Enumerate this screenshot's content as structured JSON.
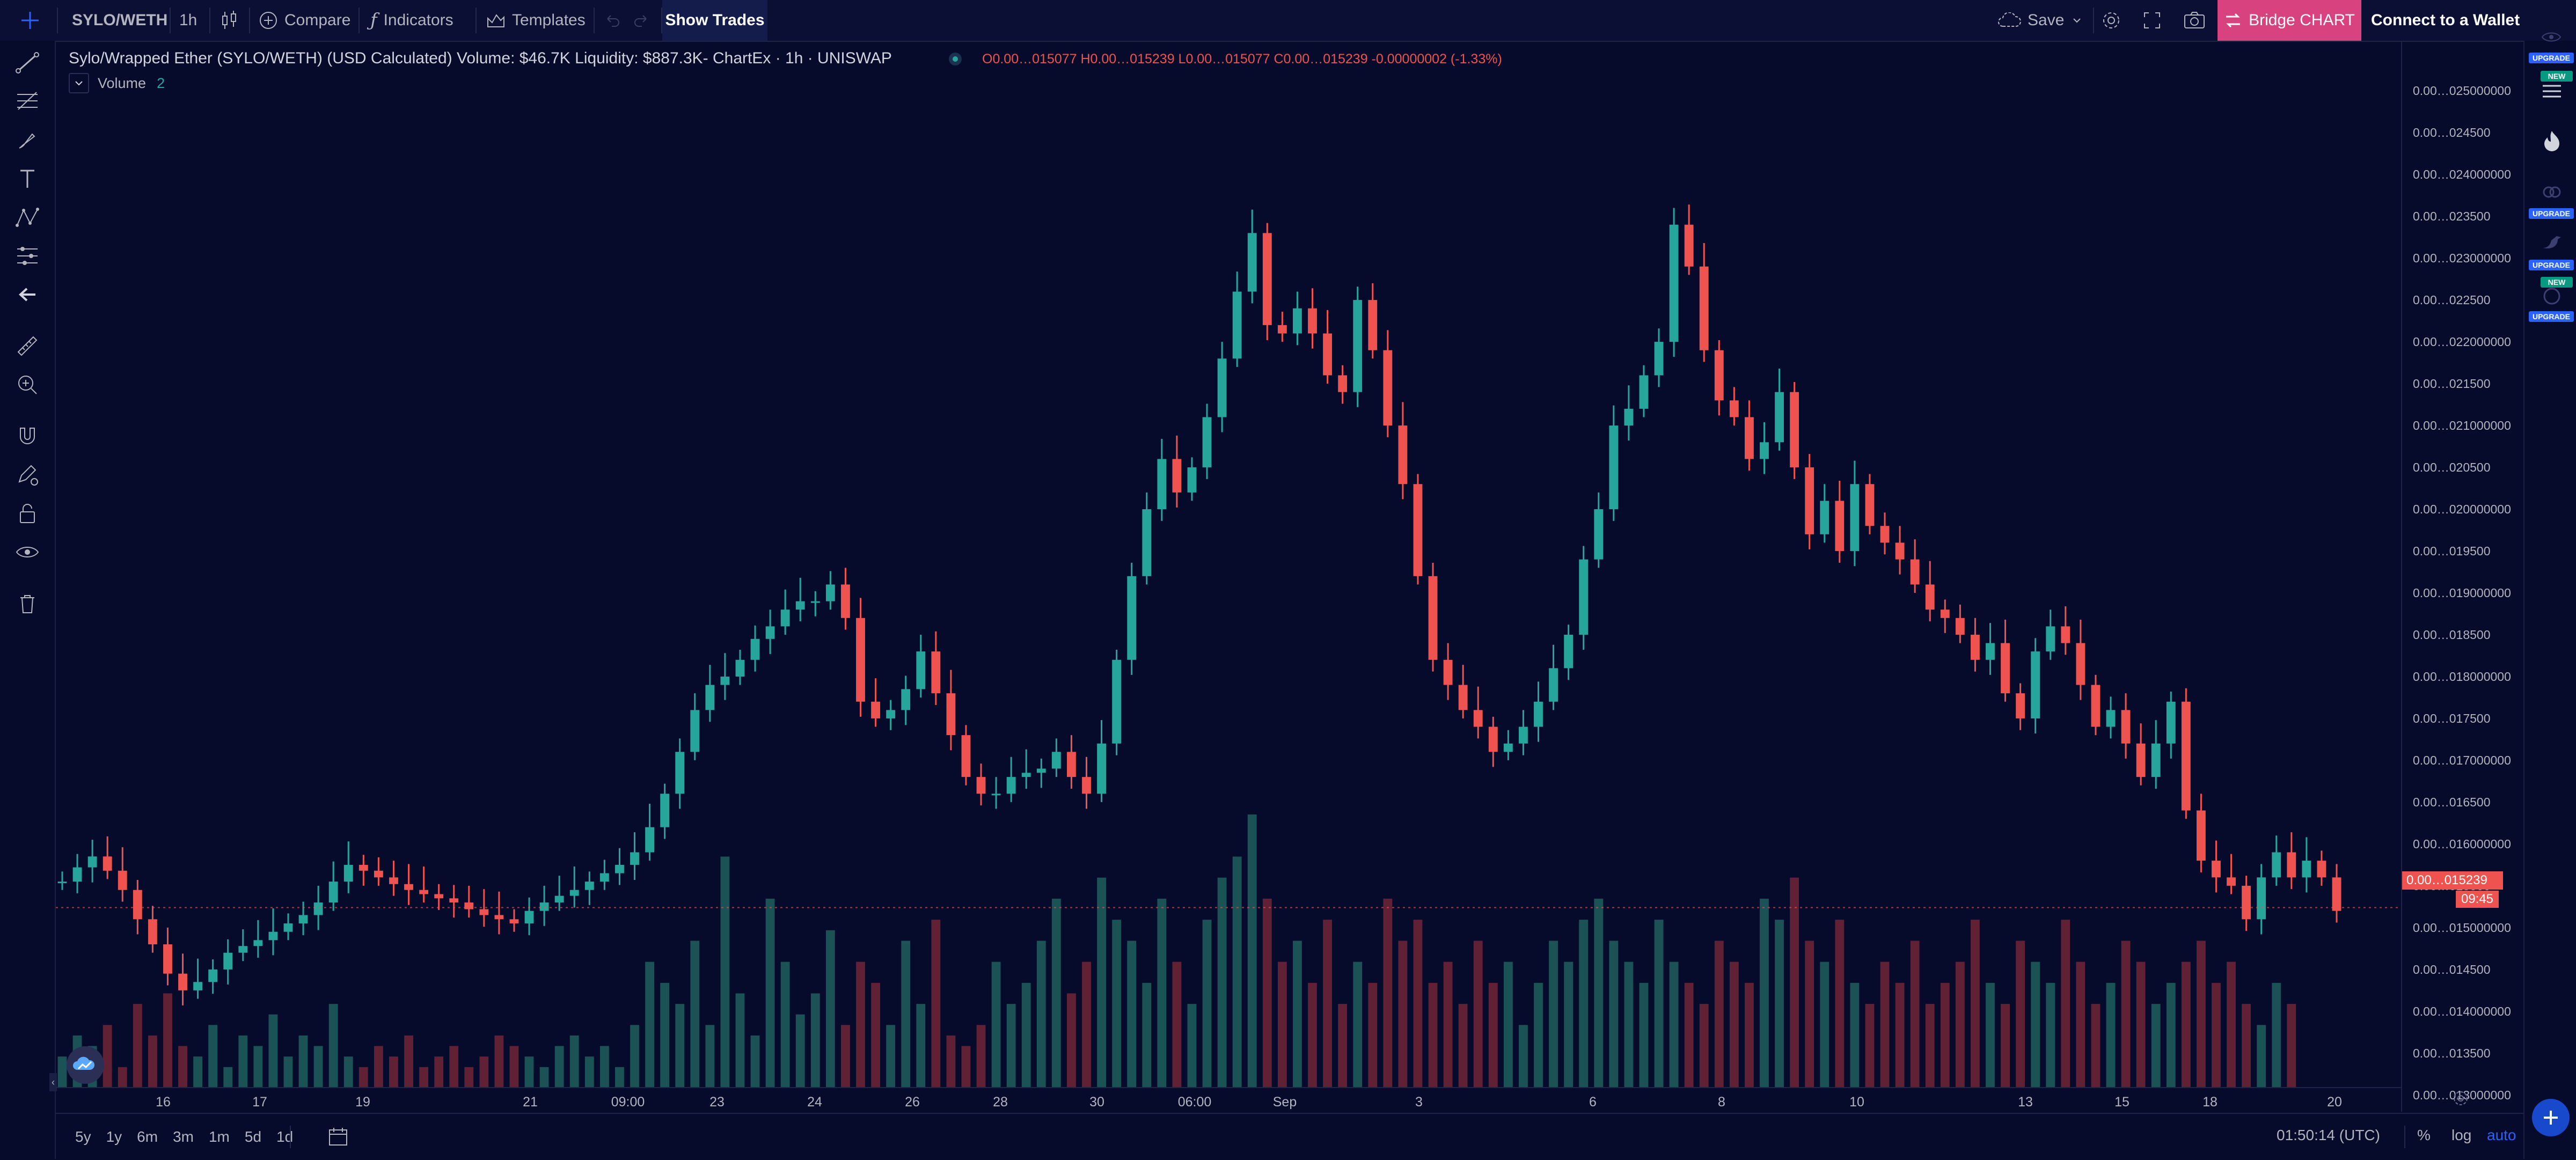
{
  "toolbar": {
    "symbol": "SYLO/WETH",
    "interval": "1h",
    "compare_label": "Compare",
    "indicators_label": "Indicators",
    "templates_label": "Templates",
    "show_trades_label": "Show Trades",
    "save_label": "Save",
    "bridge_label": "Bridge CHART",
    "connect_label": "Connect to a Wallet"
  },
  "legend": {
    "title": "Sylo/Wrapped Ether (SYLO/WETH) (USD Calculated) Volume: $46.7K Liquidity: $887.3K- ChartEx · 1h · UNISWAP",
    "ohlc": "O0.00…015077  H0.00…015239  L0.00…015077  C0.00…015239  -0.00000002  (-1.33%)",
    "volume_label": "Volume",
    "volume_value": "2"
  },
  "price_axis": {
    "ticks": [
      "0.00…025000000",
      "0.00…024500",
      "0.00…024000000",
      "0.00…023500",
      "0.00…023000000",
      "0.00…022500",
      "0.00…022000000",
      "0.00…021500",
      "0.00…021000000",
      "0.00…020500",
      "0.00…020000000",
      "0.00…019500",
      "0.00…019000000",
      "0.00…018500",
      "0.00…018000000",
      "0.00…017500",
      "0.00…017000000",
      "0.00…016500",
      "0.00…016000000",
      "0.00…015500",
      "0.00…015000000",
      "0.00…014500",
      "0.00…014000000",
      "0.00…013500",
      "0.00…013000000"
    ],
    "last_price_label": "0.00…015239",
    "countdown_label": "09:45"
  },
  "time_axis": {
    "labels": [
      "16",
      "17",
      "19",
      "21",
      "09:00",
      "23",
      "24",
      "26",
      "28",
      "30",
      "06:00",
      "Sep",
      "3",
      "6",
      "8",
      "10",
      "13",
      "15",
      "18",
      "20"
    ]
  },
  "bottom": {
    "ranges": [
      "5y",
      "1y",
      "6m",
      "3m",
      "1m",
      "5d",
      "1d"
    ],
    "clock": "01:50:14 (UTC)",
    "percent_label": "%",
    "log_label": "log",
    "auto_label": "auto"
  },
  "right_badges": {
    "upgrade": "UPGRADE",
    "new": "NEW"
  },
  "colors": {
    "background": "#060a2b",
    "up": "#26a69a",
    "down": "#ef5350",
    "bridge": "#e0458b",
    "accent": "#2962ff"
  },
  "chart_data": {
    "type": "candlestick",
    "title": "Sylo/Wrapped Ether (SYLO/WETH) (USD Calculated)",
    "interval": "1h",
    "ylim": [
      0.0128,
      0.0252
    ],
    "series": [
      {
        "name": "price (close, approx.)",
        "values": [
          0.01555,
          0.01572,
          0.01585,
          0.01568,
          0.01545,
          0.0151,
          0.0148,
          0.01445,
          0.01425,
          0.01435,
          0.0145,
          0.0147,
          0.01478,
          0.01485,
          0.01495,
          0.01505,
          0.01515,
          0.0153,
          0.01555,
          0.01575,
          0.01568,
          0.0156,
          0.01552,
          0.01545,
          0.0154,
          0.01535,
          0.0153,
          0.01522,
          0.01515,
          0.0151,
          0.01505,
          0.0152,
          0.0153,
          0.01538,
          0.01545,
          0.01555,
          0.01565,
          0.01575,
          0.0159,
          0.0162,
          0.0166,
          0.0171,
          0.0176,
          0.0179,
          0.018,
          0.0182,
          0.01845,
          0.0186,
          0.0188,
          0.0189,
          0.0189,
          0.0191,
          0.0187,
          0.0177,
          0.0175,
          0.0176,
          0.01785,
          0.0183,
          0.0178,
          0.0173,
          0.0168,
          0.0166,
          0.0166,
          0.0168,
          0.01685,
          0.0169,
          0.0171,
          0.0168,
          0.0166,
          0.0172,
          0.0182,
          0.0192,
          0.02,
          0.0206,
          0.0202,
          0.0205,
          0.0211,
          0.0218,
          0.0226,
          0.0233,
          0.0222,
          0.0221,
          0.0224,
          0.0221,
          0.0216,
          0.0214,
          0.0225,
          0.0219,
          0.021,
          0.0203,
          0.0192,
          0.0182,
          0.0179,
          0.0176,
          0.0174,
          0.0171,
          0.0172,
          0.0174,
          0.0177,
          0.0181,
          0.0185,
          0.0194,
          0.02,
          0.021,
          0.0212,
          0.0216,
          0.022,
          0.0234,
          0.0229,
          0.0219,
          0.0213,
          0.0211,
          0.0206,
          0.0208,
          0.0214,
          0.0205,
          0.0197,
          0.0201,
          0.0195,
          0.0203,
          0.0198,
          0.0196,
          0.0194,
          0.0191,
          0.0188,
          0.0187,
          0.0185,
          0.0182,
          0.0184,
          0.0178,
          0.0175,
          0.0183,
          0.0186,
          0.0184,
          0.0179,
          0.0174,
          0.0176,
          0.0172,
          0.0168,
          0.0172,
          0.0177,
          0.0164,
          0.0158,
          0.0156,
          0.0155,
          0.0151,
          0.0156,
          0.0159,
          0.0156,
          0.0158,
          0.0156,
          0.0152
        ]
      },
      {
        "name": "Volume",
        "values": [
          3,
          5,
          4,
          6,
          2,
          8,
          5,
          9,
          4,
          3,
          6,
          2,
          5,
          4,
          7,
          3,
          5,
          4,
          8,
          3,
          2,
          4,
          3,
          5,
          2,
          3,
          4,
          2,
          3,
          5,
          4,
          3,
          2,
          4,
          5,
          3,
          4,
          2,
          6,
          12,
          10,
          8,
          14,
          6,
          22,
          9,
          5,
          18,
          12,
          7,
          9,
          15,
          6,
          12,
          10,
          6,
          14,
          8,
          16,
          5,
          4,
          6,
          12,
          8,
          10,
          14,
          18,
          9,
          12,
          20,
          16,
          14,
          10,
          18,
          12,
          8,
          16,
          20,
          22,
          26,
          18,
          12,
          14,
          10,
          16,
          8,
          12,
          10,
          18,
          14,
          16,
          10,
          12,
          8,
          14,
          10,
          12,
          6,
          10,
          14,
          12,
          16,
          18,
          14,
          12,
          10,
          16,
          12,
          10,
          8,
          14,
          12,
          10,
          18,
          16,
          20,
          14,
          12,
          16,
          10,
          8,
          12,
          10,
          14,
          8,
          10,
          12,
          16,
          10,
          8,
          14,
          12,
          10,
          16,
          12,
          8,
          10,
          14,
          12,
          8,
          10,
          12,
          14,
          10,
          12,
          8,
          6,
          10,
          8
        ]
      }
    ]
  }
}
